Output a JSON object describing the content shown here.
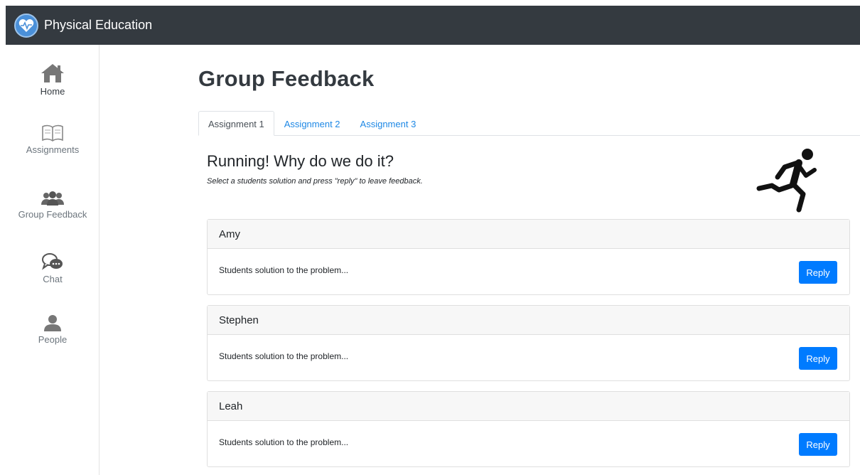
{
  "app": {
    "title": "Physical Education"
  },
  "sidebar": {
    "items": [
      {
        "label": "Home",
        "icon": "home-icon"
      },
      {
        "label": "Assignments",
        "icon": "book-icon"
      },
      {
        "label": "Group Feedback",
        "icon": "group-icon"
      },
      {
        "label": "Chat",
        "icon": "chat-icon"
      },
      {
        "label": "People",
        "icon": "person-icon"
      }
    ]
  },
  "page": {
    "title": "Group Feedback"
  },
  "tabs": [
    {
      "label": "Assignment 1",
      "active": true
    },
    {
      "label": "Assignment 2",
      "active": false
    },
    {
      "label": "Assignment 3",
      "active": false
    }
  ],
  "assignment": {
    "title": "Running! Why do we do it?",
    "instructions": "Select a students solution and press \"reply\" to leave feedback."
  },
  "submissions": [
    {
      "student": "Amy",
      "text": "Students solution to the problem...",
      "reply_label": "Reply"
    },
    {
      "student": "Stephen",
      "text": "Students solution to the problem...",
      "reply_label": "Reply"
    },
    {
      "student": "Leah",
      "text": "Students solution to the problem...",
      "reply_label": "Reply"
    }
  ],
  "colors": {
    "topbar": "#343a40",
    "accent": "#007bff",
    "link": "#1e88e5"
  }
}
